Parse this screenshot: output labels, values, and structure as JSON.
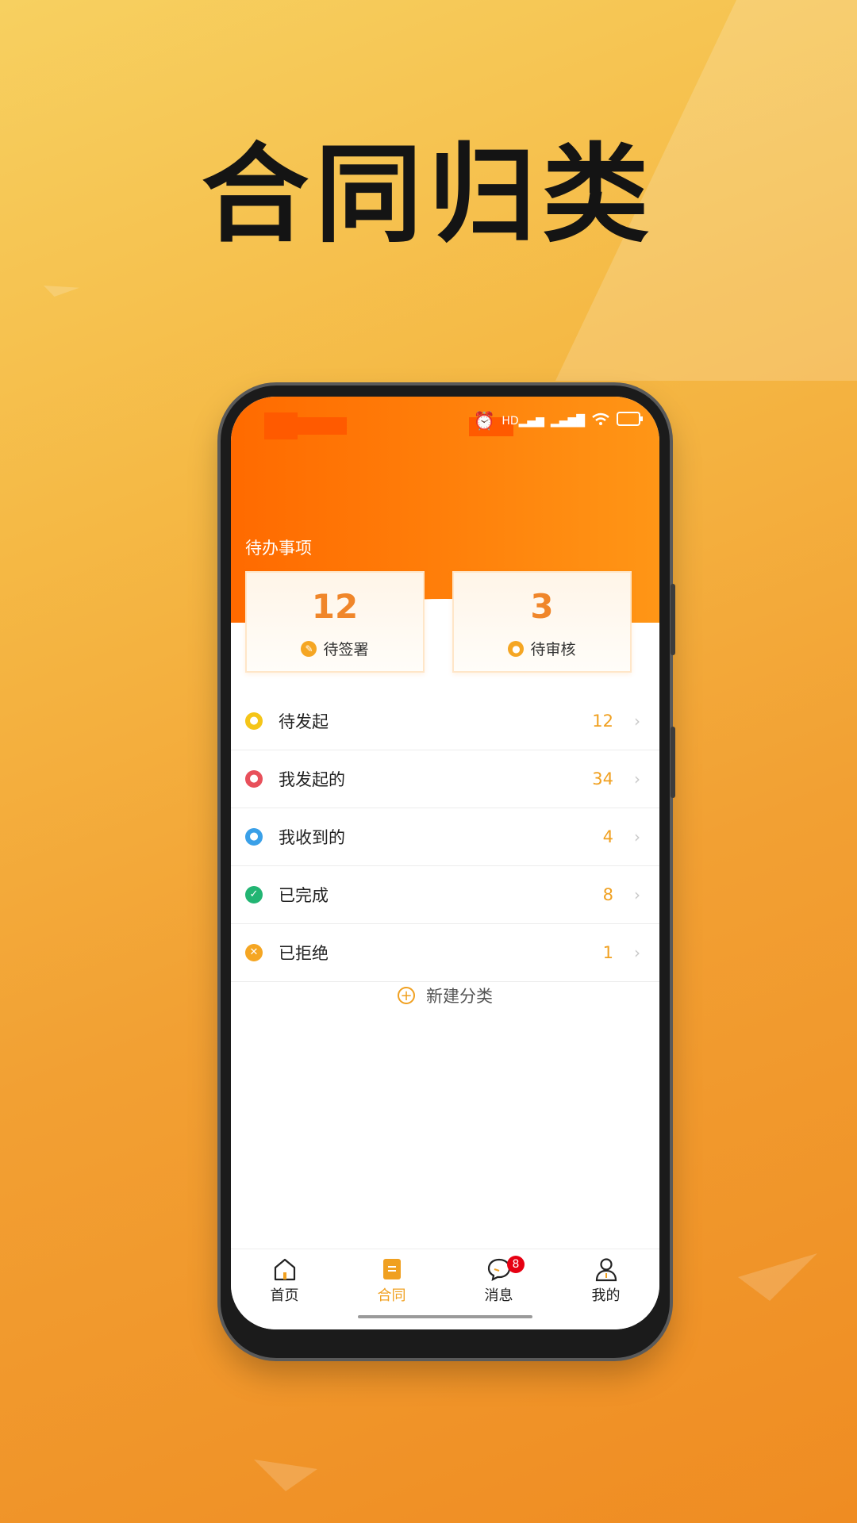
{
  "headline": "合同归类",
  "status_bar": {
    "icons": [
      "alarm-icon",
      "hd-signal-icon",
      "signal-icon",
      "wifi-icon",
      "battery-icon"
    ]
  },
  "todo": {
    "title": "待办事项",
    "cards": [
      {
        "count": "12",
        "label": "待签署",
        "icon": "pen-icon"
      },
      {
        "count": "3",
        "label": "待审核",
        "icon": "person-icon"
      }
    ]
  },
  "list": [
    {
      "label": "待发起",
      "count": "12",
      "icon": "user-yellow-icon",
      "color": "#f5c518"
    },
    {
      "label": "我发起的",
      "count": "34",
      "icon": "user-red-icon",
      "color": "#e8505b"
    },
    {
      "label": "我收到的",
      "count": "4",
      "icon": "user-blue-icon",
      "color": "#3aa0e8"
    },
    {
      "label": "已完成",
      "count": "8",
      "icon": "check-green-icon",
      "color": "#22b573"
    },
    {
      "label": "已拒绝",
      "count": "1",
      "icon": "close-orange-icon",
      "color": "#f5a623"
    }
  ],
  "new_category": "新建分类",
  "tabs": [
    {
      "label": "首页",
      "icon": "home-icon",
      "active": false
    },
    {
      "label": "合同",
      "icon": "contract-icon",
      "active": true
    },
    {
      "label": "消息",
      "icon": "message-icon",
      "active": false,
      "badge": "8"
    },
    {
      "label": "我的",
      "icon": "profile-icon",
      "active": false
    }
  ],
  "colors": {
    "accent": "#f0a020",
    "header": "#ff7f0a",
    "badge": "#e60012"
  }
}
